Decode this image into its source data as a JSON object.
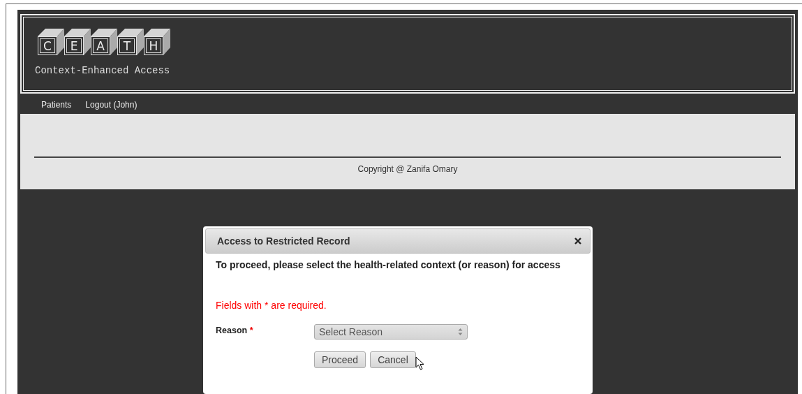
{
  "header": {
    "logo_letters": [
      "C",
      "E",
      "A",
      "T",
      "H"
    ],
    "subtitle": "Context-Enhanced Access"
  },
  "nav": [
    {
      "label": "Patients"
    },
    {
      "label": "Logout (John)"
    }
  ],
  "footer": {
    "copyright": "Copyright @ Zanifa Omary"
  },
  "dialog": {
    "title": "Access to Restricted Record",
    "intro": "To proceed, please select the health-related context (or reason) for access",
    "required_note": "Fields with * are required.",
    "field_label": "Reason",
    "required_mark": "*",
    "select": {
      "value": "Select Reason"
    },
    "buttons": [
      {
        "label": "Proceed"
      },
      {
        "label": "Cancel"
      }
    ]
  }
}
